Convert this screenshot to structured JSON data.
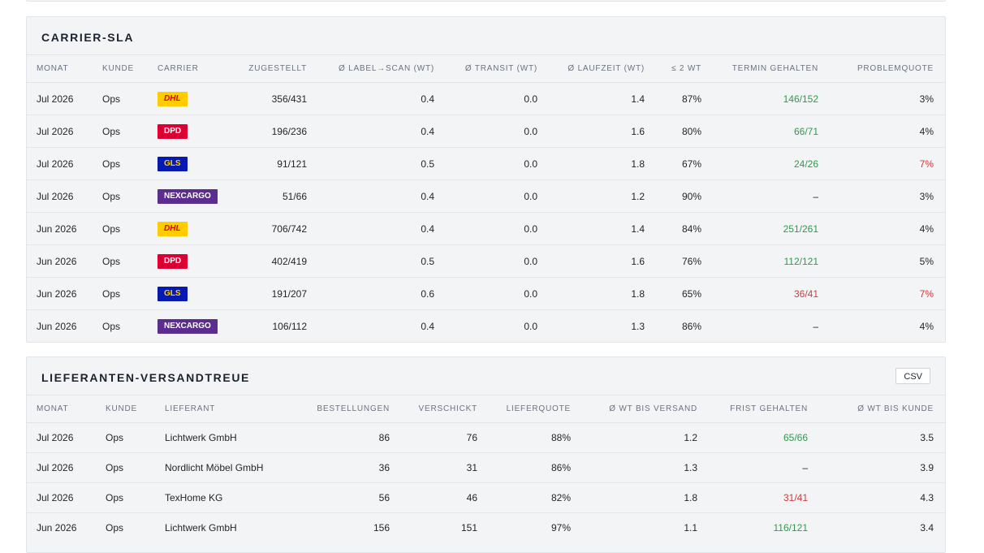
{
  "carrier_sla": {
    "title": "CARRIER-SLA",
    "columns": [
      "MONAT",
      "KUNDE",
      "CARRIER",
      "ZUGESTELLT",
      "Ø LABEL→SCAN (WT)",
      "Ø TRANSIT (WT)",
      "Ø LAUFZEIT (WT)",
      "≤ 2 WT",
      "TERMIN GEHALTEN",
      "PROBLEMQUOTE"
    ],
    "carrier_styles": {
      "DHL": {
        "bg": "#ffcc00",
        "fg": "#d40511",
        "italic": true
      },
      "DPD": {
        "bg": "#dc0032",
        "fg": "#ffffff",
        "italic": false
      },
      "GLS": {
        "bg": "#061ab1",
        "fg": "#ffd100",
        "italic": false
      },
      "NEXCARGO": {
        "bg": "#5b2d8e",
        "fg": "#ffffff",
        "italic": false
      }
    },
    "rows": [
      {
        "monat": "Jul 2026",
        "kunde": "Ops",
        "carrier": "DHL",
        "zugestellt": "356/431",
        "label_scan": "0.4",
        "transit": "0.0",
        "laufzeit": "1.4",
        "le2": "87%",
        "termin": "146/152",
        "termin_status": "green",
        "quote": "3%",
        "quote_status": "normal"
      },
      {
        "monat": "Jul 2026",
        "kunde": "Ops",
        "carrier": "DPD",
        "zugestellt": "196/236",
        "label_scan": "0.4",
        "transit": "0.0",
        "laufzeit": "1.6",
        "le2": "80%",
        "termin": "66/71",
        "termin_status": "green",
        "quote": "4%",
        "quote_status": "normal"
      },
      {
        "monat": "Jul 2026",
        "kunde": "Ops",
        "carrier": "GLS",
        "zugestellt": "91/121",
        "label_scan": "0.5",
        "transit": "0.0",
        "laufzeit": "1.8",
        "le2": "67%",
        "termin": "24/26",
        "termin_status": "green",
        "quote": "7%",
        "quote_status": "red"
      },
      {
        "monat": "Jul 2026",
        "kunde": "Ops",
        "carrier": "NEXCARGO",
        "zugestellt": "51/66",
        "label_scan": "0.4",
        "transit": "0.0",
        "laufzeit": "1.2",
        "le2": "90%",
        "termin": "–",
        "termin_status": "normal",
        "quote": "3%",
        "quote_status": "normal"
      },
      {
        "monat": "Jun 2026",
        "kunde": "Ops",
        "carrier": "DHL",
        "zugestellt": "706/742",
        "label_scan": "0.4",
        "transit": "0.0",
        "laufzeit": "1.4",
        "le2": "84%",
        "termin": "251/261",
        "termin_status": "green",
        "quote": "4%",
        "quote_status": "normal"
      },
      {
        "monat": "Jun 2026",
        "kunde": "Ops",
        "carrier": "DPD",
        "zugestellt": "402/419",
        "label_scan": "0.5",
        "transit": "0.0",
        "laufzeit": "1.6",
        "le2": "76%",
        "termin": "112/121",
        "termin_status": "green",
        "quote": "5%",
        "quote_status": "normal"
      },
      {
        "monat": "Jun 2026",
        "kunde": "Ops",
        "carrier": "GLS",
        "zugestellt": "191/207",
        "label_scan": "0.6",
        "transit": "0.0",
        "laufzeit": "1.8",
        "le2": "65%",
        "termin": "36/41",
        "termin_status": "red",
        "quote": "7%",
        "quote_status": "red"
      },
      {
        "monat": "Jun 2026",
        "kunde": "Ops",
        "carrier": "NEXCARGO",
        "zugestellt": "106/112",
        "label_scan": "0.4",
        "transit": "0.0",
        "laufzeit": "1.3",
        "le2": "86%",
        "termin": "–",
        "termin_status": "normal",
        "quote": "4%",
        "quote_status": "normal"
      }
    ]
  },
  "lieferanten": {
    "title": "LIEFERANTEN-VERSANDTREUE",
    "csv_label": "CSV",
    "columns": [
      "MONAT",
      "KUNDE",
      "LIEFERANT",
      "BESTELLUNGEN",
      "VERSCHICKT",
      "LIEFERQUOTE",
      "Ø WT BIS VERSAND",
      "FRIST GEHALTEN",
      "Ø WT BIS KUNDE"
    ],
    "rows": [
      {
        "monat": "Jul 2026",
        "kunde": "Ops",
        "lieferant": "Lichtwerk GmbH",
        "bestellungen": "86",
        "verschickt": "76",
        "quote": "88%",
        "wt_versand": "1.2",
        "frist": "65/66",
        "frist_status": "green",
        "wt_kunde": "3.5"
      },
      {
        "monat": "Jul 2026",
        "kunde": "Ops",
        "lieferant": "Nordlicht Möbel GmbH",
        "bestellungen": "36",
        "verschickt": "31",
        "quote": "86%",
        "wt_versand": "1.3",
        "frist": "–",
        "frist_status": "normal",
        "wt_kunde": "3.9"
      },
      {
        "monat": "Jul 2026",
        "kunde": "Ops",
        "lieferant": "TexHome KG",
        "bestellungen": "56",
        "verschickt": "46",
        "quote": "82%",
        "wt_versand": "1.8",
        "frist": "31/41",
        "frist_status": "red",
        "wt_kunde": "4.3"
      },
      {
        "monat": "Jun 2026",
        "kunde": "Ops",
        "lieferant": "Lichtwerk GmbH",
        "bestellungen": "156",
        "verschickt": "151",
        "quote": "97%",
        "wt_versand": "1.1",
        "frist": "116/121",
        "frist_status": "green",
        "wt_kunde": "3.4"
      }
    ]
  },
  "colors": {
    "green": "#2e9a4a",
    "red": "#d33a3a"
  }
}
